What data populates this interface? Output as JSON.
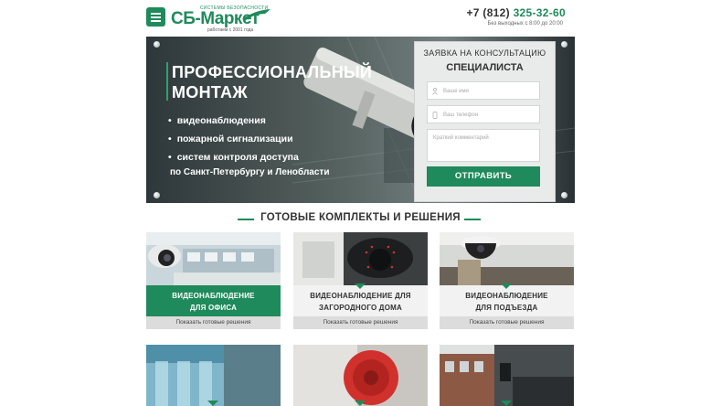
{
  "header": {
    "logo_tagline": "СИСТЕМЫ БЕЗОПАСНОСТИ",
    "logo_name": "СБ-Маркет",
    "logo_since": "работаем с 2001 года",
    "phone_prefix": "+7 (812)",
    "phone_number": "325-32-60",
    "hours": "Без выходных с 8:00 до 20:00"
  },
  "hero": {
    "title_line1": "ПРОФЕССИОНАЛЬНЫЙ",
    "title_line2": "МОНТАЖ",
    "items": [
      "видеонаблюдения",
      "пожарной сигнализации",
      "систем контроля доступа"
    ],
    "region": "по Санкт-Петербургу и Ленобласти"
  },
  "form": {
    "title_line1": "ЗАЯВКА НА КОНСУЛЬТАЦИЮ",
    "title_line2": "СПЕЦИАЛИСТА",
    "name_placeholder": "Ваше имя",
    "phone_placeholder": "Ваш телефон",
    "comment_placeholder": "Краткий комментарий",
    "submit_label": "ОТПРАВИТЬ"
  },
  "section": {
    "title": "ГОТОВЫЕ КОМПЛЕКТЫ И РЕШЕНИЯ"
  },
  "cards": [
    {
      "line1": "ВИДЕОНАБЛЮДЕНИЕ",
      "line2": "ДЛЯ ОФИСА",
      "action": "Показать готовые решения"
    },
    {
      "line1": "ВИДЕОНАБЛЮДЕНИЕ ДЛЯ",
      "line2": "ЗАГОРОДНОГО ДОМА",
      "action": "Показать готовые решения"
    },
    {
      "line1": "ВИДЕОНАБЛЮДЕНИЕ",
      "line2": "ДЛЯ ПОДЪЕЗДА",
      "action": "Показать готовые решения"
    }
  ],
  "colors": {
    "accent": "#1f8a5b",
    "card_body": "#f2f2f2",
    "card_footer": "#dcdcdc"
  }
}
